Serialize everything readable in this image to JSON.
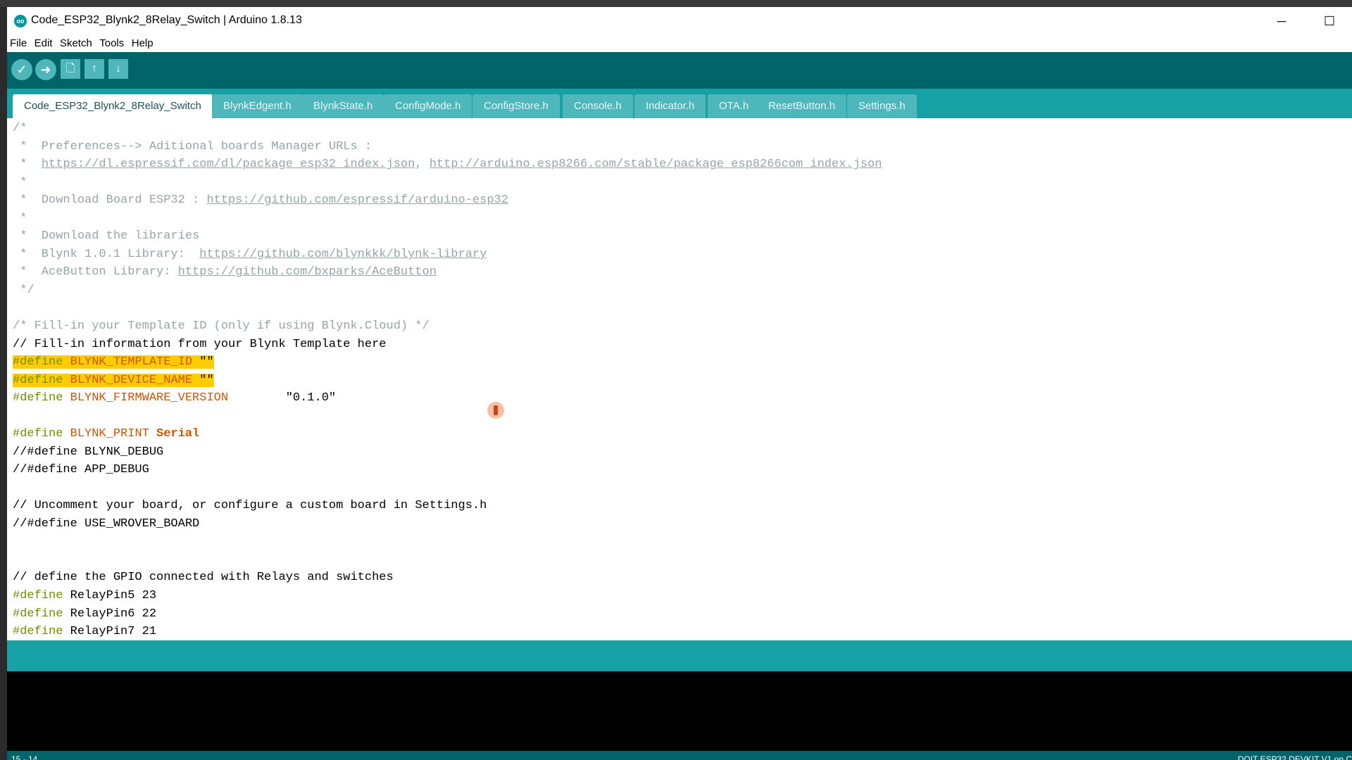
{
  "window": {
    "title": "Code_ESP32_Blynk2_8Relay_Switch | Arduino 1.8.13",
    "app_icon": "oo",
    "minimize_glyph": "─",
    "maximize_glyph": "☐"
  },
  "menu": [
    "File",
    "Edit",
    "Sketch",
    "Tools",
    "Help"
  ],
  "toolbar": {
    "verify": "✓",
    "upload": "➜",
    "new": "🗋",
    "open": "↑",
    "save": "↓"
  },
  "tabs": [
    "Code_ESP32_Blynk2_8Relay_Switch",
    "BlynkEdgent.h",
    "BlynkState.h",
    "ConfigMode.h",
    "ConfigStore.h",
    "Console.h",
    "Indicator.h",
    "OTA.h",
    "ResetButton.h",
    "Settings.h"
  ],
  "code": {
    "l1": "/*",
    "l2": " *  Preferences--> Aditional boards Manager URLs :",
    "l3_prefix": " *  ",
    "l3_url1": "https://dl.espressif.com/dl/package_esp32_index.json",
    "l3_sep": ", ",
    "l3_url2": "http://arduino.esp8266.com/stable/package_esp8266com_index.json",
    "l4": " *",
    "l5_prefix": " *  Download Board ESP32 : ",
    "l5_url": "https://github.com/espressif/arduino-esp32",
    "l6": " *",
    "l7": " *  Download the libraries",
    "l8_prefix": " *  Blynk 1.0.1 Library:  ",
    "l8_url": "https://github.com/blynkkk/blynk-library",
    "l9_prefix": " *  AceButton Library: ",
    "l9_url": "https://github.com/bxparks/AceButton",
    "l10": " */",
    "l12": "/* Fill-in your Template ID (only if using Blynk.Cloud) */",
    "l13": "// Fill-in information from your Blynk Template here",
    "define_kw": "#define",
    "l14_macro": "BLYNK_TEMPLATE_ID",
    "l14_val": "\"\"",
    "l15_macro": "BLYNK_DEVICE_NAME",
    "l15_val": "\"\"",
    "l16_macro": "BLYNK_FIRMWARE_VERSION",
    "l16_val": "\"0.1.0\"",
    "l18_macro": "BLYNK_PRINT",
    "l18_val": "Serial",
    "l19": "//#define BLYNK_DEBUG",
    "l20": "//#define APP_DEBUG",
    "l22": "// Uncomment your board, or configure a custom board in Settings.h",
    "l23": "//#define USE_WROVER_BOARD",
    "l26": "// define the GPIO connected with Relays and switches",
    "l27": "RelayPin5 23",
    "l28": "RelayPin6 22",
    "l29": "RelayPin7 21"
  },
  "status": {
    "cursor_position": "15 - 14",
    "board": "DOIT ESP32 DEVKIT V1 on C"
  }
}
